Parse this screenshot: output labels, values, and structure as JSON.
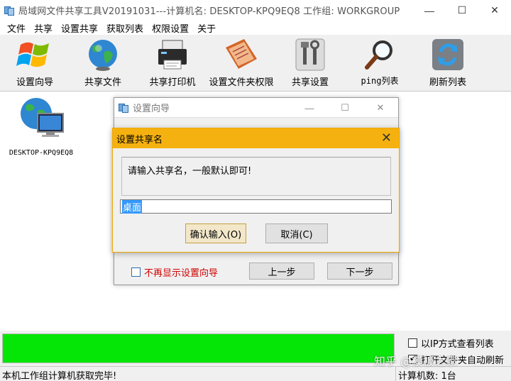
{
  "window": {
    "title": "局域网文件共享工具V20191031---计算机名: DESKTOP-KPQ9EQ8  工作组: WORKGROUP",
    "minimize": "—",
    "maximize": "☐",
    "close": "✕"
  },
  "menu": [
    "文件",
    "共享",
    "设置共享",
    "获取列表",
    "权限设置",
    "关于"
  ],
  "toolbar": [
    {
      "label": "设置向导",
      "icon": "windows-logo-icon"
    },
    {
      "label": "共享文件",
      "icon": "globe-icon"
    },
    {
      "label": "共享打印机",
      "icon": "printer-icon"
    },
    {
      "label": "设置文件夹权限",
      "icon": "folder-permission-icon"
    },
    {
      "label": "共享设置",
      "icon": "settings-tools-icon"
    },
    {
      "label": "ping列表",
      "icon": "magnifier-icon"
    },
    {
      "label": "刷新列表",
      "icon": "refresh-icon"
    }
  ],
  "computers": [
    {
      "name": "DESKTOP-KPQ9EQ8",
      "icon": "network-computer-icon"
    }
  ],
  "wizard": {
    "title": "设置向导",
    "minimize": "—",
    "maximize": "☐",
    "close": "✕",
    "no_show_label": "不再显示设置向导",
    "prev_label": "上一步",
    "next_label": "下一步"
  },
  "dialog": {
    "title": "设置共享名",
    "close": "✕",
    "prompt": "请输入共享名，一般默认即可!",
    "input_value": "桌面",
    "confirm_label": "确认输入(O)",
    "cancel_label": "取消(C)"
  },
  "options": {
    "ip_view_label": "以IP方式查看列表",
    "second_label": "打开文件夹自动刷新"
  },
  "progress": {
    "value": 100
  },
  "status": {
    "left": "本机工作组计算机获取完毕!",
    "right": "计算机数: 1台"
  },
  "watermark": "知乎 @模板之家",
  "colors": {
    "progress_fill": "#06e606",
    "dialog_title_bg": "#f5b10f",
    "no_show_text": "#d00000",
    "selection": "#3399ff"
  }
}
